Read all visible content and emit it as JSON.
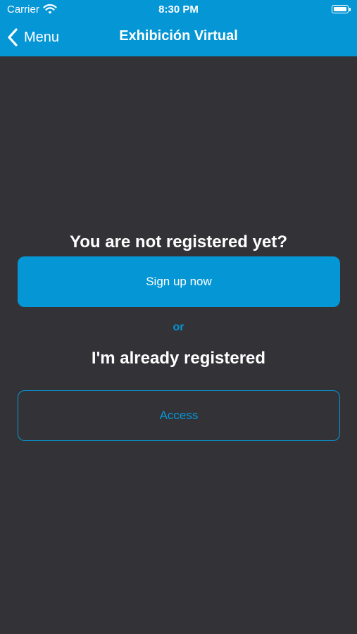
{
  "status_bar": {
    "carrier": "Carrier",
    "time": "8:30 PM",
    "wifi_icon": "wifi-icon",
    "battery_icon": "battery-icon"
  },
  "nav": {
    "back_label": "Menu",
    "back_icon": "chevron-left-icon",
    "title": "Exhibición Virtual"
  },
  "main": {
    "signup_heading": "You are not registered yet?",
    "signup_button": "Sign up now",
    "or_label": "or",
    "login_heading": "I'm already registered",
    "access_button": "Access"
  },
  "colors": {
    "accent": "#0596d6",
    "background": "#333337",
    "text": "#ffffff"
  }
}
